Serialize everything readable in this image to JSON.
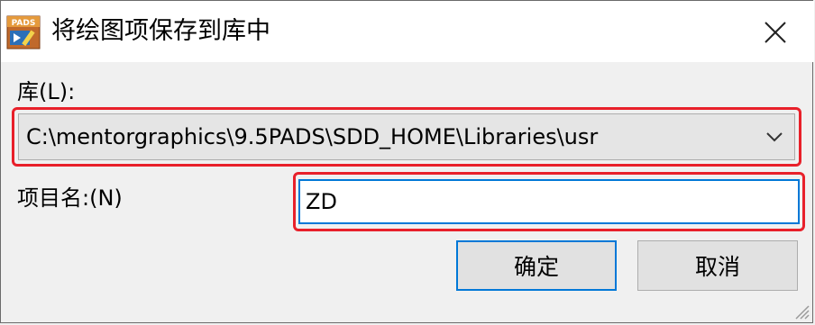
{
  "window": {
    "title": "将绘图项保存到库中",
    "app_icon_text": "PADS",
    "icons": {
      "app": "pads-app-icon",
      "close": "close-icon",
      "dropdown": "chevron-down-icon",
      "grip": "resize-grip-icon"
    }
  },
  "library": {
    "label": "库(L):",
    "selected_path": "C:\\mentorgraphics\\9.5PADS\\SDD_HOME\\Libraries\\usr"
  },
  "item_name": {
    "label": "项目名:(N)",
    "value": "ZD"
  },
  "buttons": {
    "ok_label": "确定",
    "cancel_label": "取消"
  },
  "colors": {
    "highlight": "#e8202a",
    "focus": "#0078d7"
  }
}
